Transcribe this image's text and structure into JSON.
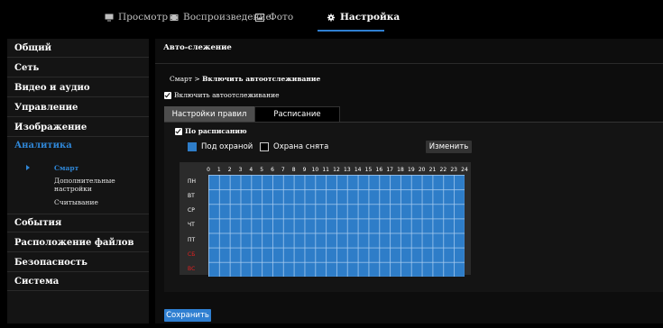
{
  "nav": {
    "tabs": [
      {
        "label": "Просмотр",
        "icon": "monitor-icon"
      },
      {
        "label": "Воспроизведение",
        "icon": "film-icon"
      },
      {
        "label": "Фото",
        "icon": "image-icon"
      },
      {
        "label": "Настройка",
        "icon": "gear-icon",
        "active": true
      }
    ]
  },
  "sidebar": {
    "items": [
      {
        "label": "Общий"
      },
      {
        "label": "Сеть"
      },
      {
        "label": "Видео и аудио"
      },
      {
        "label": "Управление"
      },
      {
        "label": "Изображение"
      },
      {
        "label": "Аналитика",
        "active": true
      },
      {
        "label": "События"
      },
      {
        "label": "Расположение файлов"
      },
      {
        "label": "Безопасность"
      },
      {
        "label": "Система"
      }
    ],
    "analytics_sub": [
      {
        "label": "Смарт",
        "active": true
      },
      {
        "label": "Дополнительные настройки"
      },
      {
        "label": "Считывание"
      }
    ]
  },
  "main": {
    "title": "Авто-слежение",
    "breadcrumb_root": "Смарт",
    "breadcrumb_sep": ">",
    "breadcrumb_current": "Включить автоотслеживание",
    "enable_label": "Включить автоотслеживание",
    "tabs": {
      "rules": "Настройки правил",
      "schedule": "Расписание"
    },
    "by_schedule_label": "По расписанию",
    "legend": {
      "armed": "Под охраной",
      "disarmed": "Охрана снята"
    },
    "change_button": "Изменить",
    "hours": [
      "0",
      "1",
      "2",
      "3",
      "4",
      "5",
      "6",
      "7",
      "8",
      "9",
      "10",
      "11",
      "12",
      "13",
      "14",
      "15",
      "16",
      "17",
      "18",
      "19",
      "20",
      "21",
      "22",
      "23",
      "24"
    ],
    "days": [
      "ПН",
      "ВТ",
      "СР",
      "ЧТ",
      "ПТ",
      "СБ",
      "ВС"
    ],
    "weekend_days": [
      "СБ",
      "ВС"
    ],
    "schedule_state": "all armed",
    "save_button": "Сохранить"
  },
  "colors": {
    "accent": "#2f7fd1",
    "armed": "#2e7dc8",
    "weekend": "#e02020"
  }
}
